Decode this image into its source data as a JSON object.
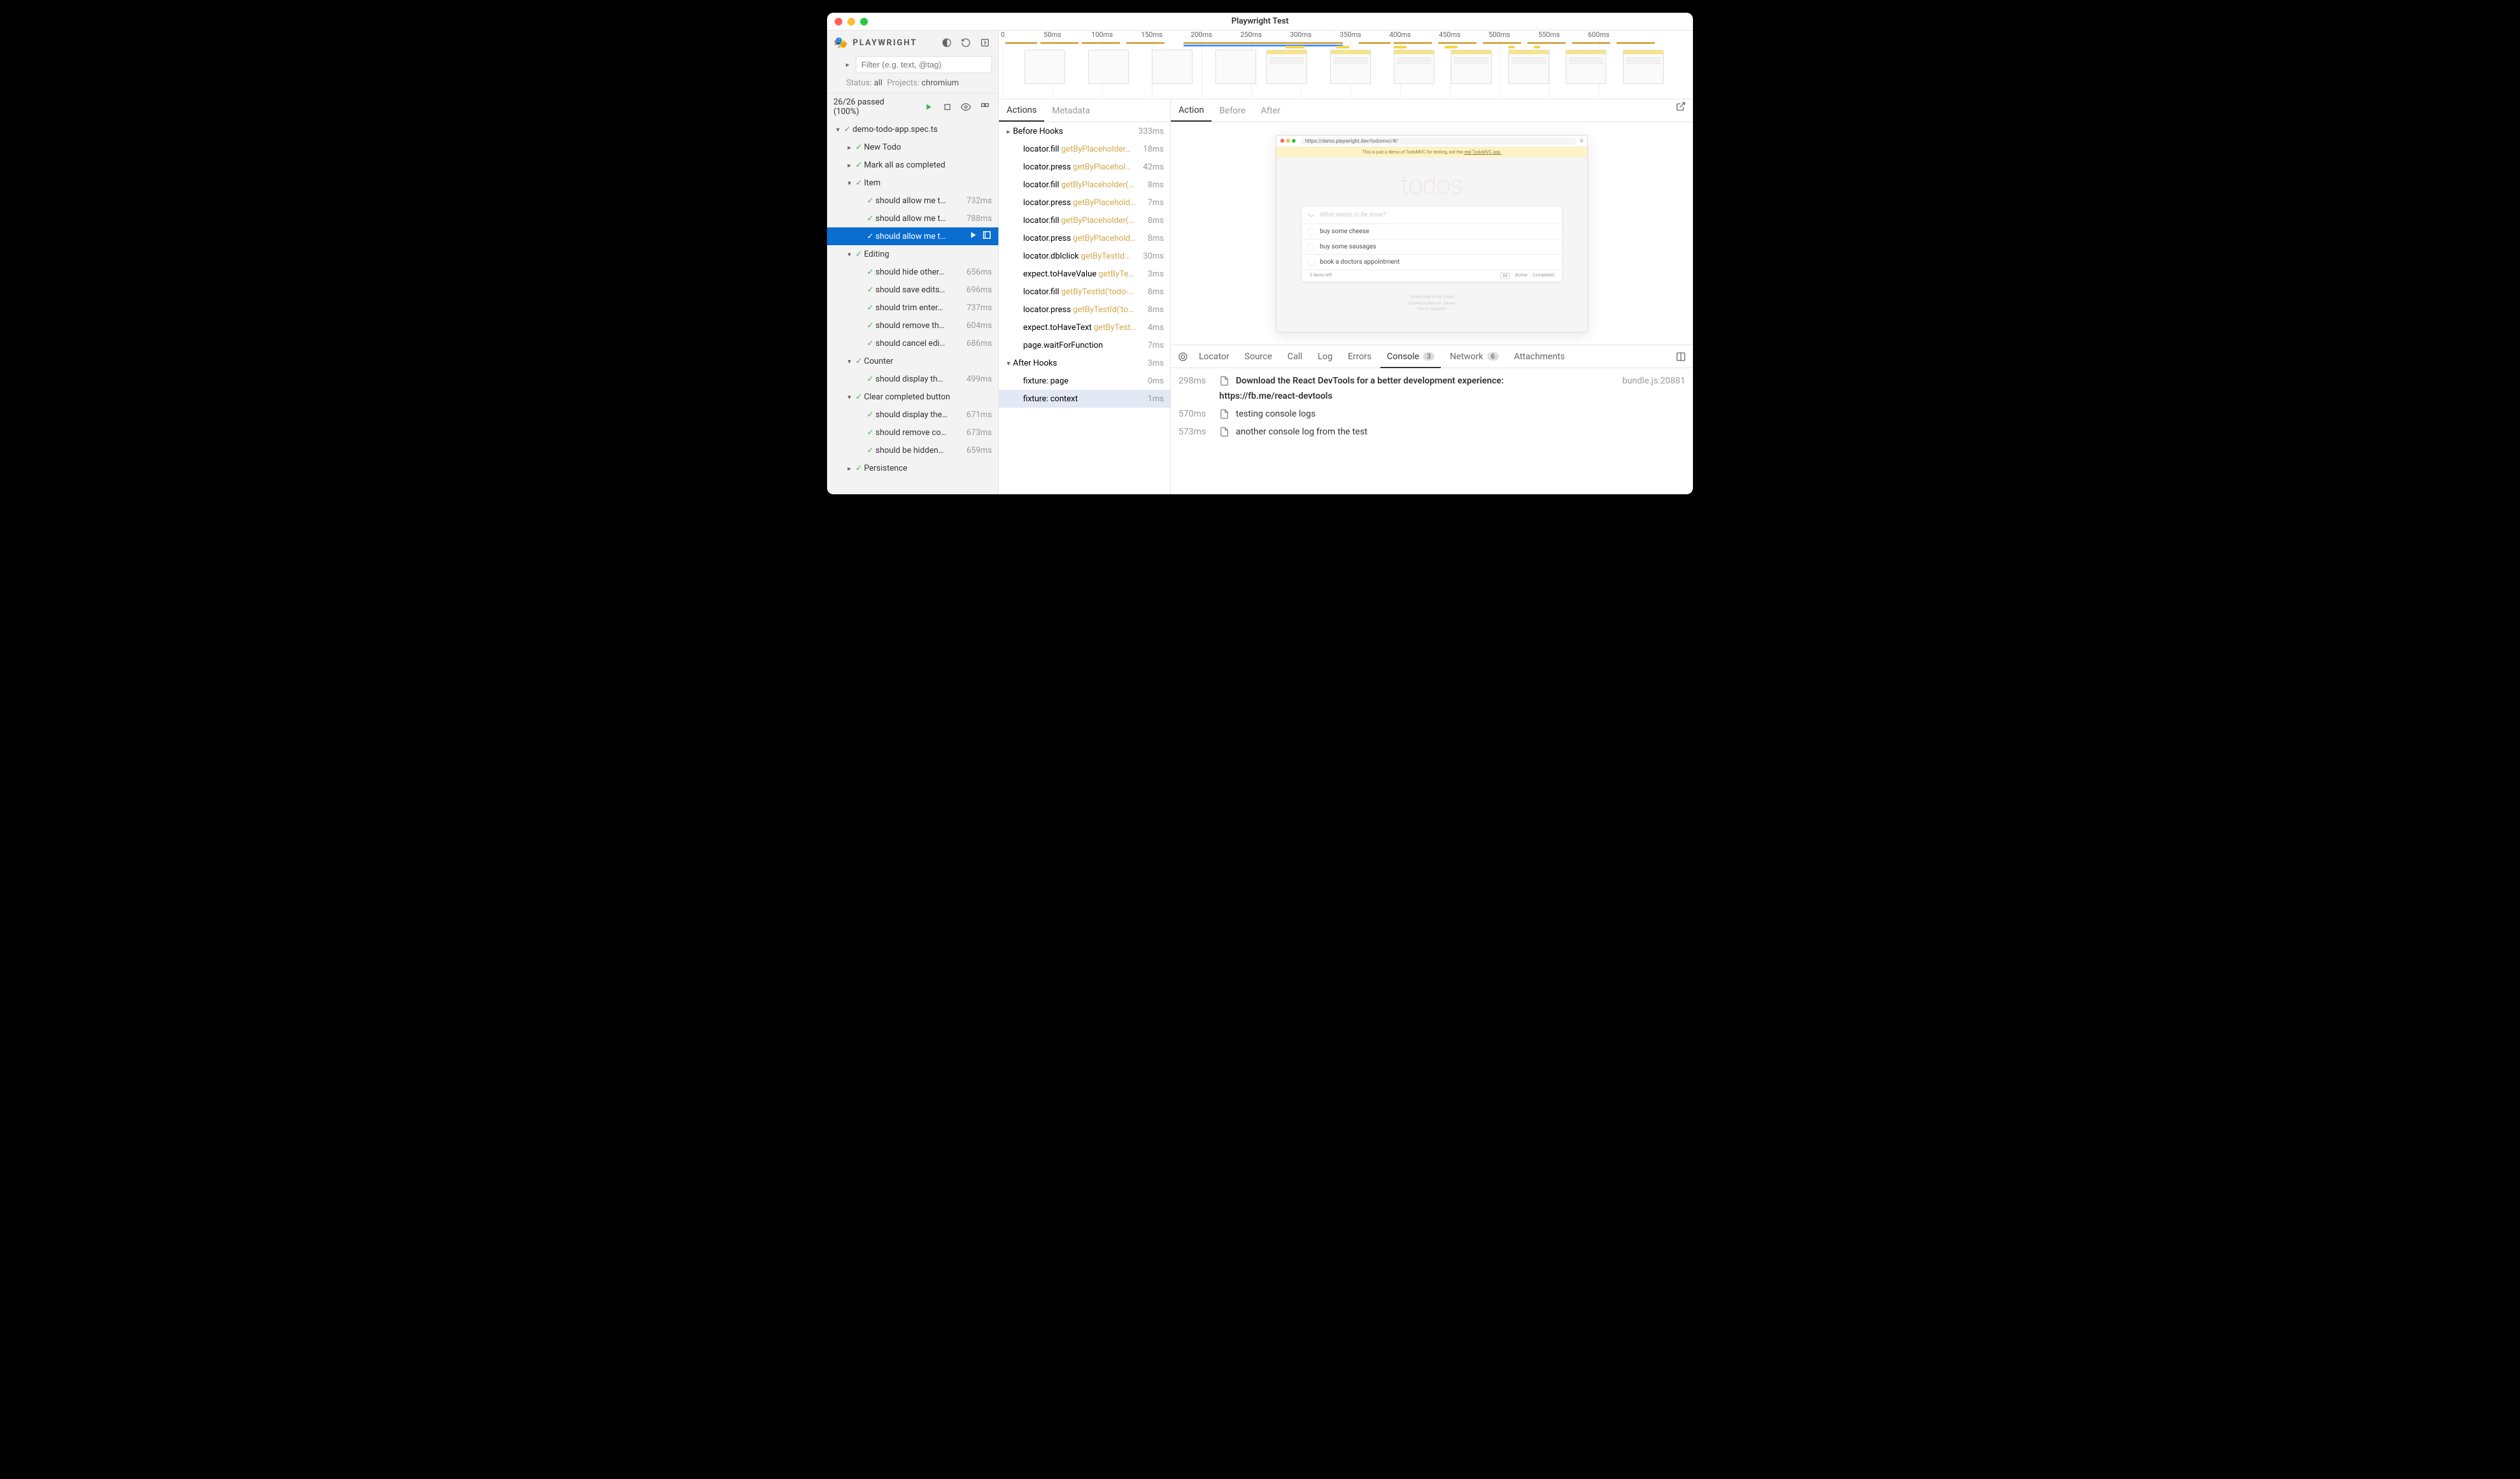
{
  "title": "Playwright Test",
  "brand": "PLAYWRIGHT",
  "filter_placeholder": "Filter (e.g. text, @tag)",
  "status": {
    "label": "Status:",
    "value": "all",
    "projects_label": "Projects:",
    "project": "chromium"
  },
  "summary": "26/26 passed (100%)",
  "tree": [
    {
      "depth": 0,
      "chev": "▾",
      "label": "demo-todo-app.spec.ts"
    },
    {
      "depth": 1,
      "chev": "▸",
      "label": "New Todo"
    },
    {
      "depth": 1,
      "chev": "▸",
      "label": "Mark all as completed"
    },
    {
      "depth": 1,
      "chev": "▾",
      "label": "Item"
    },
    {
      "depth": 2,
      "chev": "",
      "label": "should allow me t…",
      "dur": "732ms"
    },
    {
      "depth": 2,
      "chev": "",
      "label": "should allow me t…",
      "dur": "788ms"
    },
    {
      "depth": 2,
      "chev": "",
      "label": "should allow me t…",
      "dur": "",
      "selected": true
    },
    {
      "depth": 1,
      "chev": "▾",
      "label": "Editing"
    },
    {
      "depth": 2,
      "chev": "",
      "label": "should hide other…",
      "dur": "656ms"
    },
    {
      "depth": 2,
      "chev": "",
      "label": "should save edits…",
      "dur": "696ms"
    },
    {
      "depth": 2,
      "chev": "",
      "label": "should trim enter…",
      "dur": "737ms"
    },
    {
      "depth": 2,
      "chev": "",
      "label": "should remove th…",
      "dur": "604ms"
    },
    {
      "depth": 2,
      "chev": "",
      "label": "should cancel edi…",
      "dur": "686ms"
    },
    {
      "depth": 1,
      "chev": "▾",
      "label": "Counter"
    },
    {
      "depth": 2,
      "chev": "",
      "label": "should display th…",
      "dur": "499ms"
    },
    {
      "depth": 1,
      "chev": "▾",
      "label": "Clear completed button"
    },
    {
      "depth": 2,
      "chev": "",
      "label": "should display the…",
      "dur": "671ms"
    },
    {
      "depth": 2,
      "chev": "",
      "label": "should remove co…",
      "dur": "673ms"
    },
    {
      "depth": 2,
      "chev": "",
      "label": "should be hidden…",
      "dur": "659ms"
    },
    {
      "depth": 1,
      "chev": "▸",
      "label": "Persistence"
    }
  ],
  "timeline_ticks": [
    "0",
    "50ms",
    "100ms",
    "150ms",
    "200ms",
    "250ms",
    "300ms",
    "350ms",
    "400ms",
    "450ms",
    "500ms",
    "550ms",
    "600ms"
  ],
  "actions_tabs": [
    "Actions",
    "Metadata"
  ],
  "actions": [
    {
      "chev": "▸",
      "label": "Before Hooks",
      "loc": "",
      "dur": "333ms",
      "indent": 0
    },
    {
      "chev": "",
      "label": "locator.fill",
      "loc": "getByPlaceholder…",
      "dur": "18ms",
      "indent": 1
    },
    {
      "chev": "",
      "label": "locator.press",
      "loc": "getByPlacehol…",
      "dur": "42ms",
      "indent": 1
    },
    {
      "chev": "",
      "label": "locator.fill",
      "loc": "getByPlaceholder(…",
      "dur": "8ms",
      "indent": 1
    },
    {
      "chev": "",
      "label": "locator.press",
      "loc": "getByPlacehold…",
      "dur": "7ms",
      "indent": 1
    },
    {
      "chev": "",
      "label": "locator.fill",
      "loc": "getByPlaceholder(…",
      "dur": "8ms",
      "indent": 1
    },
    {
      "chev": "",
      "label": "locator.press",
      "loc": "getByPlacehold…",
      "dur": "8ms",
      "indent": 1
    },
    {
      "chev": "",
      "label": "locator.dblclick",
      "loc": "getByTestId…",
      "dur": "30ms",
      "indent": 1
    },
    {
      "chev": "",
      "label": "expect.toHaveValue",
      "loc": "getByTe…",
      "dur": "3ms",
      "indent": 1
    },
    {
      "chev": "",
      "label": "locator.fill",
      "loc": "getByTestId('todo-…",
      "dur": "8ms",
      "indent": 1
    },
    {
      "chev": "",
      "label": "locator.press",
      "loc": "getByTestId('to…",
      "dur": "8ms",
      "indent": 1
    },
    {
      "chev": "",
      "label": "expect.toHaveText",
      "loc": "getByTest…",
      "dur": "4ms",
      "indent": 1
    },
    {
      "chev": "",
      "label": "page.waitForFunction",
      "loc": "",
      "dur": "7ms",
      "indent": 1
    },
    {
      "chev": "▾",
      "label": "After Hooks",
      "loc": "",
      "dur": "3ms",
      "indent": 0
    },
    {
      "chev": "",
      "label": "fixture: page",
      "loc": "",
      "dur": "0ms",
      "indent": 1
    },
    {
      "chev": "",
      "label": "fixture: context",
      "loc": "",
      "dur": "1ms",
      "indent": 1,
      "selected": true
    }
  ],
  "preview_tabs": [
    "Action",
    "Before",
    "After"
  ],
  "browser_url": "https://demo.playwright.dev/todomvc/#/",
  "banner_text": "This is just a demo of TodoMVC for testing, not the ",
  "banner_link": "real TodoMVC app.",
  "todos_title": "todos",
  "todo_placeholder": "What needs to be done?",
  "todos": [
    "buy some cheese",
    "buy some sausages",
    "book a doctors appointment"
  ],
  "todo_footer": {
    "left": "3 items left",
    "all": "All",
    "active": "Active",
    "completed": "Completed"
  },
  "bottom_tabs": [
    {
      "label": "Locator"
    },
    {
      "label": "Source"
    },
    {
      "label": "Call"
    },
    {
      "label": "Log"
    },
    {
      "label": "Errors"
    },
    {
      "label": "Console",
      "badge": "3",
      "active": true
    },
    {
      "label": "Network",
      "badge": "6"
    },
    {
      "label": "Attachments"
    }
  ],
  "console": [
    {
      "time": "298ms",
      "msg": "Download the React DevTools for a better development experience:",
      "bold": true,
      "src": "bundle.js:20881"
    },
    {
      "link": "https://fb.me/react-devtools"
    },
    {
      "time": "570ms",
      "msg": "testing console logs"
    },
    {
      "time": "573ms",
      "msg": "another console log from the test"
    }
  ]
}
